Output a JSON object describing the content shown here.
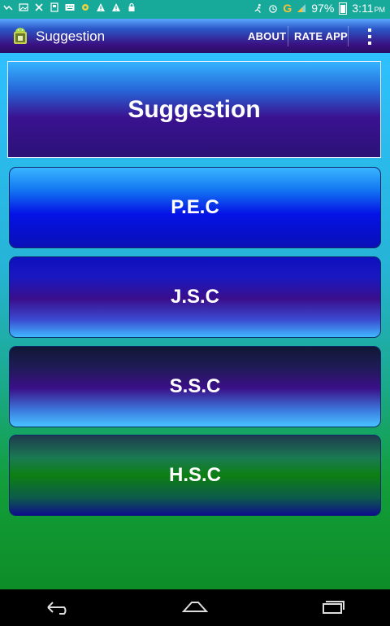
{
  "status_bar": {
    "battery": "97%",
    "time": "3:11",
    "ampm": "PM",
    "network": "G"
  },
  "action_bar": {
    "title": "Suggestion",
    "about_label": "ABOUT",
    "rate_label": "RATE APP"
  },
  "main": {
    "header_title": "Suggestion",
    "buttons": [
      {
        "label": "P.E.C"
      },
      {
        "label": "J.S.C"
      },
      {
        "label": "S.S.C"
      },
      {
        "label": "H.S.C"
      }
    ]
  },
  "colors": {
    "status_bar": "#17a99a",
    "action_bar_top": "#5aa7ff",
    "action_bar_bottom": "#2a0d62",
    "content_top": "#2ec0ff",
    "content_bottom": "#0e8d27"
  }
}
